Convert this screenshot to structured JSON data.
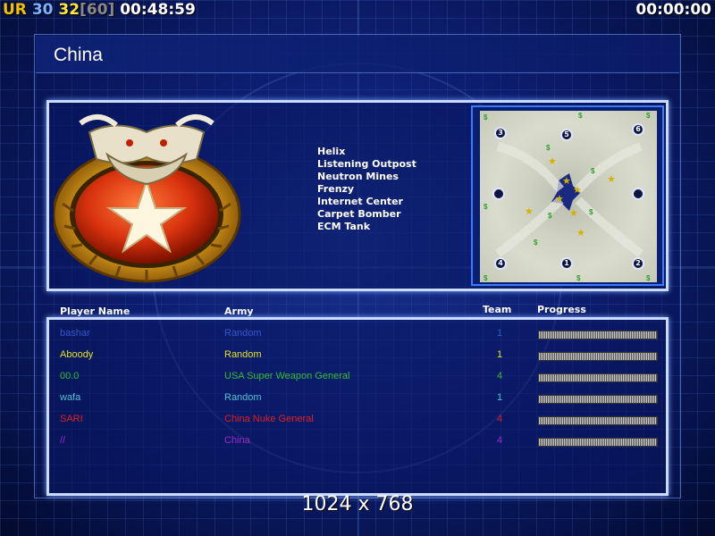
{
  "hud": {
    "ur": "UR",
    "n1": "30",
    "n2": "32",
    "cap": "[60]",
    "elapsed": "00:48:59",
    "timer": "00:00:00"
  },
  "title": "China",
  "general_units": [
    "Helix",
    "Listening Outpost",
    "Neutron Mines",
    "Frenzy",
    "Internet Center",
    "Carpet Bomber",
    "ECM Tank"
  ],
  "minimap": {
    "start_positions": [
      "3",
      "5",
      "6",
      "",
      "",
      "4",
      "1",
      "2"
    ]
  },
  "table": {
    "headers": {
      "name": "Player Name",
      "army": "Army",
      "team": "Team",
      "progress": "Progress"
    },
    "rows": [
      {
        "name": "bashar",
        "army": "Random",
        "team": "1",
        "color": "#3a56c8",
        "progress": 1.0
      },
      {
        "name": "Aboody",
        "army": "Random",
        "team": "1",
        "color": "#e4e22a",
        "progress": 1.0
      },
      {
        "name": "00.0",
        "army": "USA Super Weapon General",
        "team": "4",
        "color": "#2fbf2f",
        "progress": 1.0
      },
      {
        "name": "wafa",
        "army": "Random",
        "team": "1",
        "color": "#4fc3d2",
        "progress": 1.0
      },
      {
        "name": "SARI",
        "army": "China Nuke General",
        "team": "4",
        "color": "#e02020",
        "progress": 1.0
      },
      {
        "name": "//",
        "army": "China",
        "team": "4",
        "color": "#a02ac8",
        "progress": 1.0
      }
    ]
  },
  "resolution": "1024 x 768",
  "colors": {
    "accent": "#c9dbff",
    "background": "#0d1f73"
  }
}
